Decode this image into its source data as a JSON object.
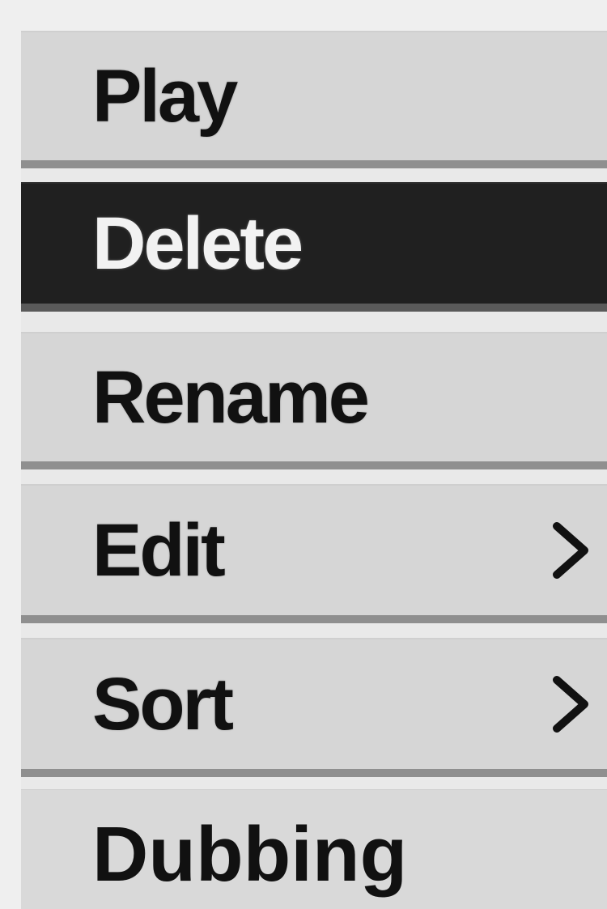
{
  "menu": {
    "items": [
      {
        "label": "Play",
        "selected": false,
        "has_submenu": false
      },
      {
        "label": "Delete",
        "selected": true,
        "has_submenu": false
      },
      {
        "label": "Rename",
        "selected": false,
        "has_submenu": false
      },
      {
        "label": "Edit",
        "selected": false,
        "has_submenu": true,
        "icon": "chevron-right-icon"
      },
      {
        "label": "Sort",
        "selected": false,
        "has_submenu": true,
        "icon": "chevron-right-icon"
      },
      {
        "label": "Dubbing",
        "selected": false,
        "has_submenu": false
      }
    ]
  },
  "colors": {
    "background": "#efefef",
    "item_bg": "#d6d6d6",
    "item_shadow": "#8f8f8f",
    "selected_bg": "#202020",
    "selected_text": "#f2f2f2",
    "text": "#111111"
  }
}
